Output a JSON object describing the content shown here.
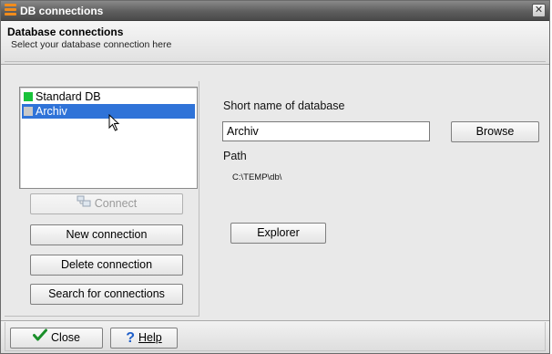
{
  "window": {
    "title": "DB connections",
    "close_glyph": "✕"
  },
  "header": {
    "title": "Database connections",
    "subtitle": "Select your database connection here"
  },
  "connections": {
    "items": [
      {
        "label": "Standard DB",
        "status_color": "#19c23a",
        "selected": false
      },
      {
        "label": "Archiv",
        "status_color": "#c8c8c8",
        "selected": true
      }
    ],
    "buttons": {
      "connect": "Connect",
      "new": "New connection",
      "delete": "Delete connection",
      "search": "Search for connections"
    }
  },
  "details": {
    "short_name_label": "Short name of database",
    "short_name_value": "Archiv",
    "browse_label": "Browse",
    "path_label": "Path",
    "path_value": "C:\\TEMP\\db\\",
    "explorer_label": "Explorer"
  },
  "footer": {
    "close_label": "Close",
    "help_label": "Help"
  },
  "colors": {
    "accent": "#2f73d8",
    "titlebar": "#5e5e5e",
    "icon_orange": "#f28c1c"
  }
}
